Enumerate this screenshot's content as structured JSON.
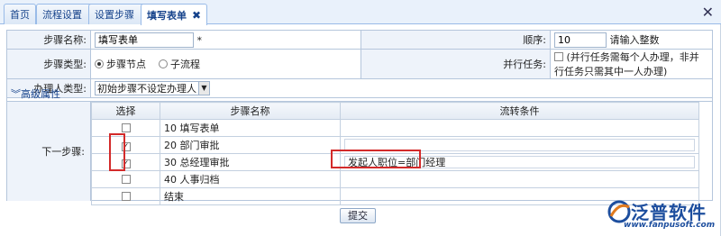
{
  "tabs": [
    {
      "label": "首页",
      "closable": false
    },
    {
      "label": "流程设置",
      "closable": true
    },
    {
      "label": "设置步骤",
      "closable": true
    },
    {
      "label": "填写表单",
      "closable": true,
      "active": true
    }
  ],
  "form": {
    "step_name_label": "步骤名称:",
    "step_name_value": "填写表单",
    "required_mark": "*",
    "order_label": "顺序:",
    "order_value": "10",
    "order_hint": "请输入整数",
    "step_type_label": "步骤类型:",
    "step_type_options": [
      "步骤节点",
      "子流程"
    ],
    "step_type_selected": "步骤节点",
    "parallel_label": "并行任务:",
    "parallel_hint": "(并行任务需每个人办理，非并行任务只需其中一人办理)",
    "handler_type_label": "办理人类型:",
    "handler_type_value": "初始步骤不设定办理人",
    "advanced_label": "高级属性"
  },
  "next_steps": {
    "label": "下一步骤:",
    "headers": [
      "选择",
      "步骤名称",
      "流转条件"
    ],
    "rows": [
      {
        "checked": false,
        "name": "10 填写表单",
        "condition": ""
      },
      {
        "checked": true,
        "name": "20 部门审批",
        "condition": ""
      },
      {
        "checked": true,
        "name": "30 总经理审批",
        "condition": "发起人职位=部门经理"
      },
      {
        "checked": false,
        "name": "40 人事归档",
        "condition": ""
      },
      {
        "checked": false,
        "name": "结束",
        "condition": ""
      }
    ]
  },
  "submit_label": "提交",
  "logo": {
    "brand": "泛普软件",
    "url": "www.fanpusoft.com"
  },
  "colors": {
    "accent": "#15428b",
    "highlight": "#d32a2a",
    "logo": "#1d4e9e"
  }
}
